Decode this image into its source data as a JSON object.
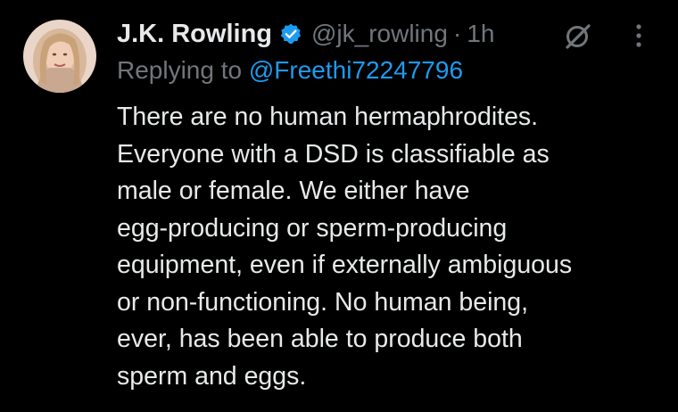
{
  "tweet": {
    "author": {
      "name": "J.K. Rowling",
      "handle": "@jk_rowling",
      "verified": true,
      "verified_color": "#1d9bf0"
    },
    "separator": "·",
    "timestamp": "1h",
    "replying_prefix": "Replying to ",
    "replying_to": "@Freethi72247796",
    "link_color": "#1d9bf0",
    "text_lines": [
      "There are no human hermaphrodites.",
      "Everyone with a DSD is classifiable as",
      "male or female. We either have",
      "egg-producing or sperm-producing",
      "equipment, even if externally ambiguous",
      "or non-functioning. No human being,",
      "ever, has been able to produce both",
      "sperm and eggs."
    ],
    "icons": {
      "avatar": "profile-photo",
      "verified": "verified-badge-icon",
      "grok": "grok-icon",
      "more": "more-options-icon"
    }
  }
}
